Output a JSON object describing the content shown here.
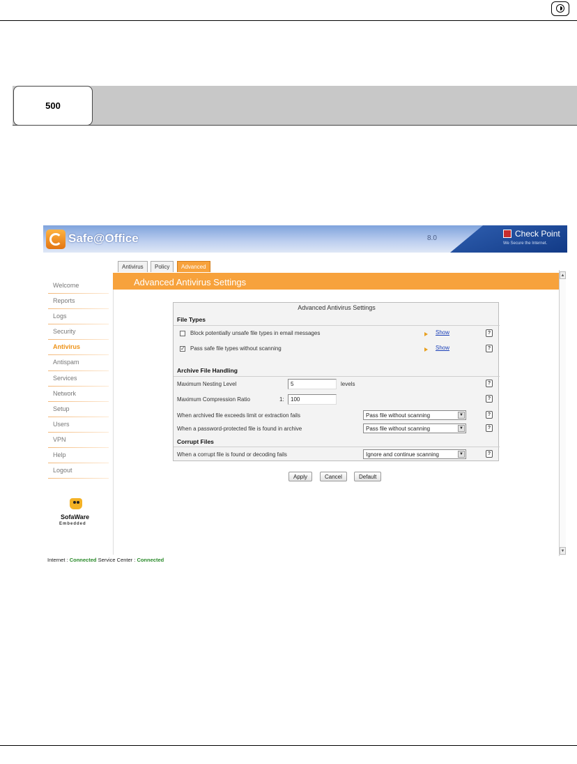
{
  "page": {
    "badge": "500"
  },
  "app": {
    "title": "Safe@Office",
    "version": "8.0",
    "vendor": "Check Point",
    "vendor_tagline": "We Secure the Internet."
  },
  "nav": {
    "items": [
      {
        "label": "Welcome",
        "active": false
      },
      {
        "label": "Reports",
        "active": false
      },
      {
        "label": "Logs",
        "active": false
      },
      {
        "label": "Security",
        "active": false
      },
      {
        "label": "Antivirus",
        "active": true
      },
      {
        "label": "Antispam",
        "active": false
      },
      {
        "label": "Services",
        "active": false
      },
      {
        "label": "Network",
        "active": false
      },
      {
        "label": "Setup",
        "active": false
      },
      {
        "label": "Users",
        "active": false
      },
      {
        "label": "VPN",
        "active": false
      },
      {
        "label": "Help",
        "active": false
      },
      {
        "label": "Logout",
        "active": false
      }
    ],
    "brand_name": "SofaWare",
    "brand_tag": "Embedded"
  },
  "tabs": [
    {
      "label": "Antivirus",
      "active": false
    },
    {
      "label": "Policy",
      "active": false
    },
    {
      "label": "Advanced",
      "active": true
    }
  ],
  "content": {
    "title": "Advanced Antivirus Settings"
  },
  "panel": {
    "title": "Advanced Antivirus Settings",
    "file_types": {
      "heading": "File Types",
      "block_unsafe": {
        "label": "Block potentially unsafe file types in email messages",
        "checked": false,
        "link": "Show"
      },
      "pass_safe": {
        "label": "Pass safe file types without scanning",
        "checked": true,
        "link": "Show"
      }
    },
    "archive": {
      "heading": "Archive File Handling",
      "max_nesting": {
        "label": "Maximum Nesting Level",
        "value": "5",
        "unit": "levels"
      },
      "max_ratio": {
        "label": "Maximum Compression Ratio",
        "prefix": "1:",
        "value": "100"
      },
      "exceeds": {
        "label": "When archived file exceeds limit or extraction fails",
        "value": "Pass file without scanning"
      },
      "password": {
        "label": "When a password-protected file is found in archive",
        "value": "Pass file without scanning"
      }
    },
    "corrupt": {
      "heading": "Corrupt Files",
      "when_corrupt": {
        "label": "When a corrupt file is found or decoding fails",
        "value": "Ignore and continue scanning"
      }
    },
    "help_glyph": "?",
    "check_glyph": "✓",
    "dropdown_glyph": "▼"
  },
  "buttons": {
    "apply": "Apply",
    "cancel": "Cancel",
    "default": "Default"
  },
  "status": {
    "internet_label": "Internet :",
    "internet_value": "Connected",
    "service_label": "Service Center :",
    "service_value": "Connected"
  },
  "colors": {
    "accent": "#f7a23c",
    "connected": "#2a8a2a",
    "link": "#1a3fb8"
  }
}
